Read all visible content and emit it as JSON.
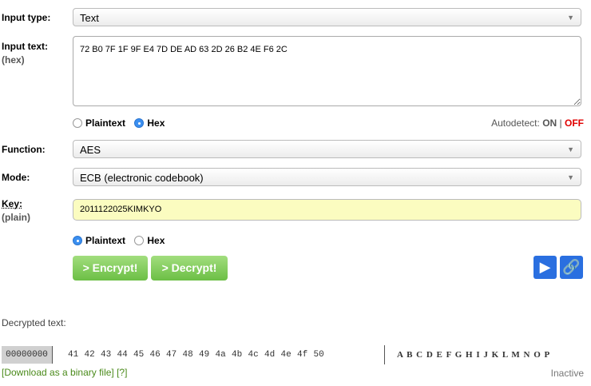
{
  "input_type": {
    "label": "Input type:",
    "value": "Text"
  },
  "input_text": {
    "label": "Input text:",
    "sub": "(hex)",
    "value": "72 B0 7F 1F 9F E4 7D DE AD 63 2D 26 B2 4E F6 2C"
  },
  "input_format": {
    "plaintext": "Plaintext",
    "hex": "Hex",
    "selected": "Hex"
  },
  "autodetect": {
    "label": "Autodetect:",
    "on": "ON",
    "sep": "|",
    "off": "OFF",
    "off_color": "#e00000"
  },
  "function": {
    "label": "Function:",
    "value": "AES"
  },
  "mode": {
    "label": "Mode:",
    "value": "ECB (electronic codebook)"
  },
  "key": {
    "label": "Key:",
    "sub": "(plain)",
    "value": "2011122025KIMKYO"
  },
  "key_format": {
    "plaintext": "Plaintext",
    "hex": "Hex",
    "selected": "Plaintext"
  },
  "buttons": {
    "encrypt": "> Encrypt!",
    "decrypt": "> Decrypt!",
    "play_icon": "play-icon",
    "link_icon": "link-icon"
  },
  "output": {
    "label": "Decrypted text:",
    "offset": "00000000",
    "bytes": [
      "41",
      "42",
      "43",
      "44",
      "45",
      "46",
      "47",
      "48",
      "49",
      "4a",
      "4b",
      "4c",
      "4d",
      "4e",
      "4f",
      "50"
    ],
    "ascii": "A B C D E F G H I J K L M N O P",
    "download": "[Download as a binary file]",
    "help": "[?]",
    "status": "Inactive"
  }
}
